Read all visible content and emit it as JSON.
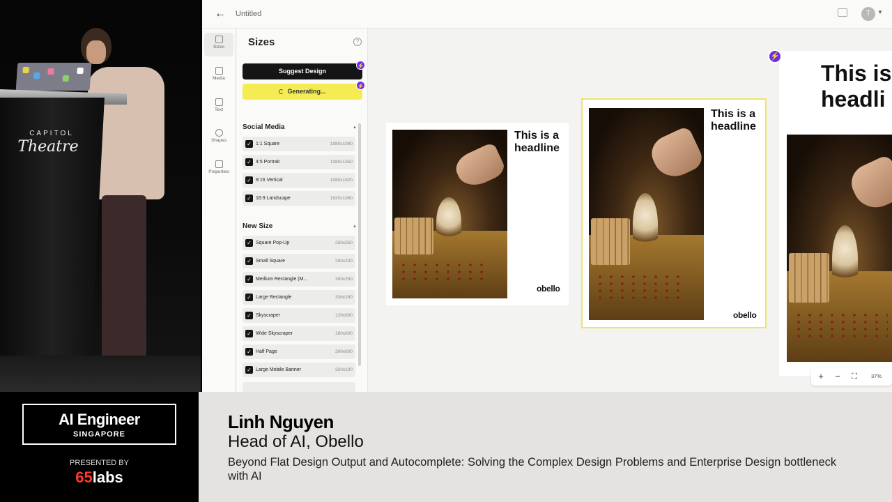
{
  "stage": {
    "lectern_venue_top": "CAPITOL",
    "lectern_venue_script": "Theatre"
  },
  "app": {
    "topbar": {
      "doc_title": "Untitled",
      "avatar_initial": "T"
    },
    "rail": [
      {
        "label": "Sizes",
        "icon": "sizes-icon",
        "active": true
      },
      {
        "label": "Media",
        "icon": "media-icon"
      },
      {
        "label": "Text",
        "icon": "text-icon"
      },
      {
        "label": "Shapes",
        "icon": "shapes-icon"
      },
      {
        "label": "Properties",
        "icon": "properties-icon"
      }
    ],
    "panel": {
      "title": "Sizes",
      "suggest_label": "Suggest Design",
      "generating_label": "Generating...",
      "social_media_heading": "Social Media",
      "social_media": [
        {
          "name": "1:1 Square",
          "dims": "1080x1080"
        },
        {
          "name": "4:5 Portrait",
          "dims": "1080x1350"
        },
        {
          "name": "9:16 Vertical",
          "dims": "1080x1920"
        },
        {
          "name": "16:9 Landscape",
          "dims": "1920x1080"
        }
      ],
      "new_size_heading": "New Size",
      "new_size": [
        {
          "name": "Square Pop-Up",
          "dims": "250x250"
        },
        {
          "name": "Small Square",
          "dims": "200x200"
        },
        {
          "name": "Medium Rectangle (M...",
          "dims": "300x250"
        },
        {
          "name": "Large Rectangle",
          "dims": "336x280"
        },
        {
          "name": "Skyscraper",
          "dims": "120x600"
        },
        {
          "name": "Wide Skyscraper",
          "dims": "160x600"
        },
        {
          "name": "Half Page",
          "dims": "300x600"
        },
        {
          "name": "Large Mobile Banner",
          "dims": "320x100"
        }
      ]
    },
    "canvas": {
      "headline": "This is a headline",
      "headline_partial": "This is headli",
      "logo": "obello",
      "zoom": "37%"
    },
    "colors": {
      "accent_yellow": "#f4ec52",
      "accent_purple": "#6b2ee8",
      "button_dark": "#151515"
    }
  },
  "lower_third": {
    "brand_title": "AI Engineer",
    "brand_sub": "SINGAPORE",
    "presented_by": "PRESENTED BY",
    "sponsor_num": "65",
    "sponsor_word": "labs",
    "speaker_name": "Linh Nguyen",
    "speaker_role": "Head of AI, Obello",
    "talk_title": "Beyond Flat Design Output and Autocomplete: Solving the Complex Design Problems and Enterprise Design bottleneck with AI"
  }
}
